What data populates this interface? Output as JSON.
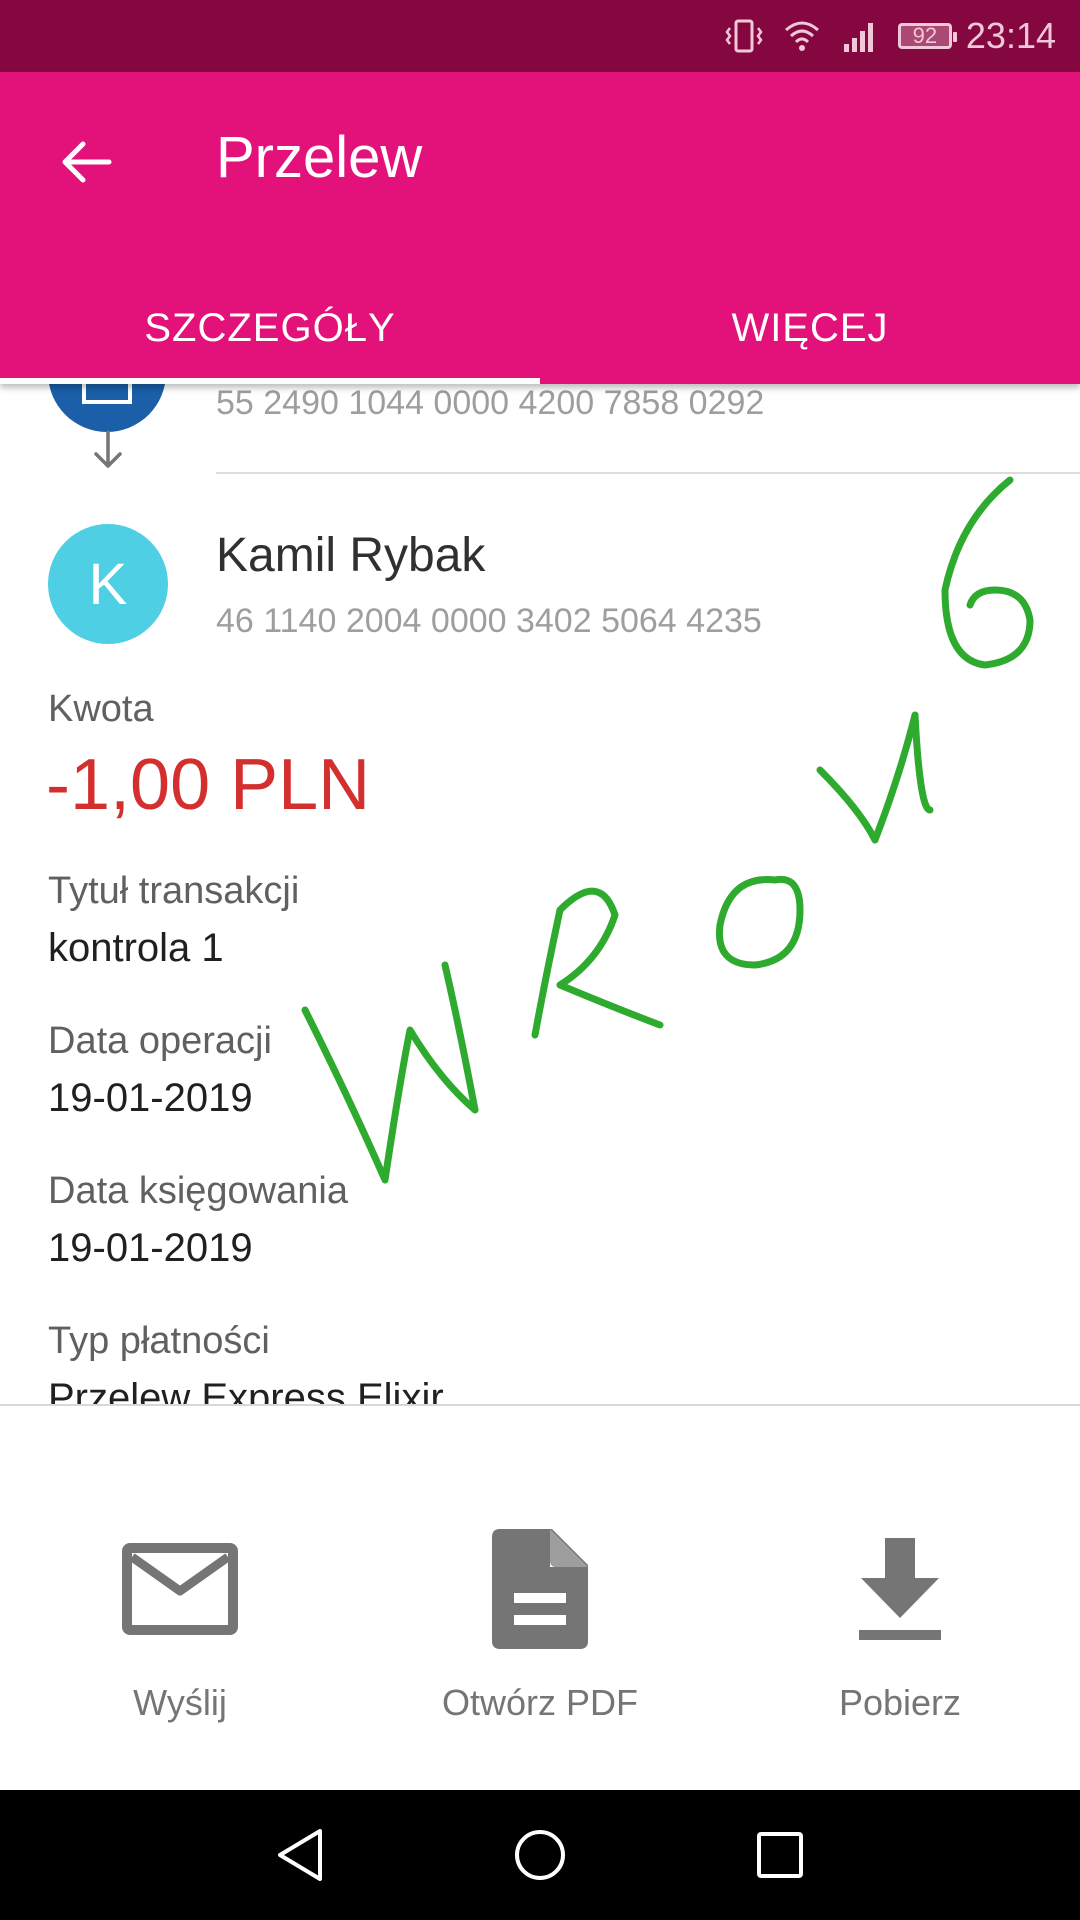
{
  "status_bar": {
    "battery": "92",
    "time": "23:14"
  },
  "app_bar": {
    "title": "Przelew"
  },
  "tabs": [
    {
      "label": "SZCZEGÓŁY",
      "active": true
    },
    {
      "label": "WIĘCEJ",
      "active": false
    }
  ],
  "transfer": {
    "sender_account": "55 2490 1044 0000 4200 7858 0292",
    "recipient": {
      "initial": "K",
      "name": "Kamil Rybak",
      "account": "46 1140 2004 0000 3402 5064 4235"
    },
    "amount_label": "Kwota",
    "amount": "-1,00 PLN",
    "fields": [
      {
        "label": "Tytuł transakcji",
        "value": "kontrola 1"
      },
      {
        "label": "Data operacji",
        "value": "19-01-2019"
      },
      {
        "label": "Data księgowania",
        "value": "19-01-2019"
      },
      {
        "label": "Typ płatności",
        "value": "Przelew Express Elixir"
      }
    ]
  },
  "actions": [
    {
      "label": "Wyślij",
      "icon": "mail-icon"
    },
    {
      "label": "Otwórz PDF",
      "icon": "document-icon"
    },
    {
      "label": "Pobierz",
      "icon": "download-icon"
    }
  ],
  "colors": {
    "status_bar": "#85073f",
    "app_bar": "#e2127a",
    "amount": "#d32f2f",
    "recipient_avatar": "#4fcfe3",
    "sender_avatar": "#1a5fa8",
    "annotation": "#2eaa2e"
  }
}
